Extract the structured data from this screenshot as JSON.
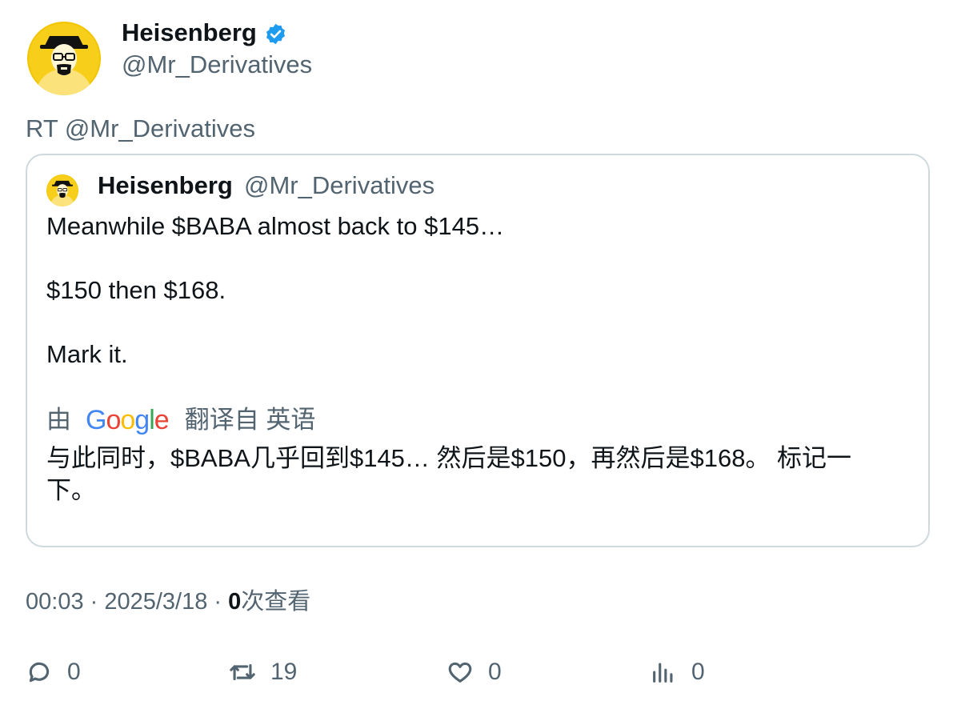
{
  "author": {
    "display_name": "Heisenberg",
    "handle": "@Mr_Derivatives",
    "verified_icon": "verified-badge-icon"
  },
  "retweet_line": "RT @Mr_Derivatives",
  "quoted_tweet": {
    "display_name": "Heisenberg",
    "handle": "@Mr_Derivatives",
    "lines": [
      "Meanwhile $BABA almost back to $145…",
      "$150 then $168.",
      "Mark it."
    ],
    "translation": {
      "prefix": "由",
      "provider": "Google",
      "suffix": "翻译自 英语",
      "text": "与此同时，$BABA几乎回到$145… 然后是$150，再然后是$168。 标记一下。"
    }
  },
  "meta": {
    "time": "00:03",
    "sep": " · ",
    "date": "2025/3/18",
    "views_count": "0",
    "views_label": "次查看"
  },
  "actions": {
    "replies": "0",
    "retweets": "19",
    "likes": "0",
    "views": "0"
  },
  "colors": {
    "text_primary": "#0f1419",
    "text_secondary": "#536471",
    "border": "#cfd9de",
    "verified": "#1d9bf0",
    "avatar_bg": "#f2c500"
  }
}
